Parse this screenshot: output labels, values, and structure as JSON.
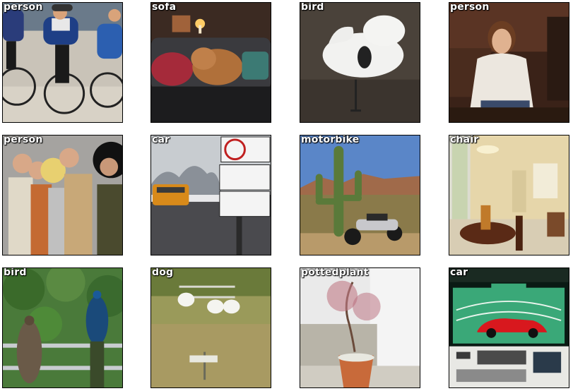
{
  "tiles": [
    {
      "label": "person",
      "scene": "cyclists"
    },
    {
      "label": "sofa",
      "scene": "dog-on-sofa"
    },
    {
      "label": "bird",
      "scene": "swan"
    },
    {
      "label": "person",
      "scene": "woman-at-table"
    },
    {
      "label": "person",
      "scene": "costume-group"
    },
    {
      "label": "car",
      "scene": "street-signs-bus"
    },
    {
      "label": "motorbike",
      "scene": "desert-cactus-motorbike"
    },
    {
      "label": "chair",
      "scene": "dining-room"
    },
    {
      "label": "bird",
      "scene": "peacocks"
    },
    {
      "label": "dog",
      "scene": "goats-in-field"
    },
    {
      "label": "pottedplant",
      "scene": "potted-tree"
    },
    {
      "label": "car",
      "scene": "red-car-display"
    }
  ]
}
